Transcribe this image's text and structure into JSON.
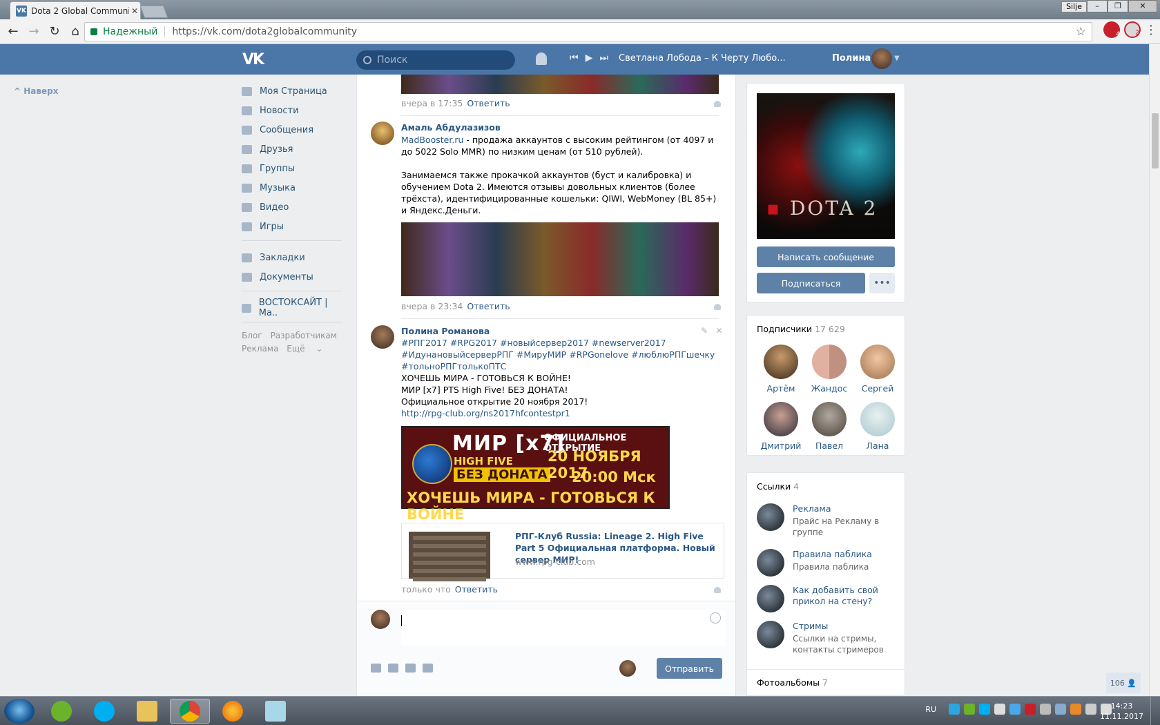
{
  "browser": {
    "tab_title": "Dota 2 Global Communi",
    "tab_favicon": "vk",
    "window_user": "Silje",
    "secure_label": "Надежный",
    "url": "https://vk.com/dota2globalcommunity",
    "ext_badges": [
      "4",
      "2"
    ]
  },
  "vk_header": {
    "logo": "VK",
    "search_placeholder": "Поиск",
    "track": "Светлана Лобода – К Черту Любо...",
    "user_name": "Полина"
  },
  "left_nav": {
    "back_to_top": "Наверх",
    "items": [
      {
        "label": "Моя Страница",
        "icon": "home-icon"
      },
      {
        "label": "Новости",
        "icon": "news-icon"
      },
      {
        "label": "Сообщения",
        "icon": "messages-icon"
      },
      {
        "label": "Друзья",
        "icon": "friends-icon"
      },
      {
        "label": "Группы",
        "icon": "groups-icon"
      },
      {
        "label": "Музыка",
        "icon": "music-icon"
      },
      {
        "label": "Видео",
        "icon": "video-icon"
      },
      {
        "label": "Игры",
        "icon": "games-icon"
      }
    ],
    "items2": [
      {
        "label": "Закладки",
        "icon": "star-icon"
      },
      {
        "label": "Документы",
        "icon": "document-icon"
      }
    ],
    "items3": [
      {
        "label": "ВОСТОКСАЙТ | Ма..",
        "icon": "group-icon"
      }
    ],
    "footer": [
      "Блог",
      "Разработчикам",
      "Реклама",
      "Ещё"
    ]
  },
  "wall": {
    "comment0": {
      "time": "вчера в 17:35",
      "reply": "Ответить"
    },
    "comment1": {
      "author": "Амаль Абдулазизов",
      "link": "MadBooster.ru",
      "text1": " - продажа аккаунтов с высоким рейтингом (от 4097 и до 5022 Solo MMR) по низким ценам (от 510 рублей).",
      "text2": "Занимаемся также прокачкой аккаунтов (буст и калибровка) и обучением Dota 2. Имеются отзывы довольных клиентов (более трёхста), идентифицированные кошельки: QIWI, WebMoney (BL 85+) и Яндекс.Деньги.",
      "time": "вчера в 23:34",
      "reply": "Ответить"
    },
    "comment2": {
      "author": "Полина Романова",
      "tags": "#РПГ2017 #RPG2017 #новыйсервер2017 #newserver2017 #ИдунановыйсерверРПГ #МируМИР #RPGonelove #люблюРПГшечку #тольноРПГтолькоПТС",
      "line1": "ХОЧЕШЬ МИРА - ГОТОВЬСЯ К ВОЙНЕ!",
      "line2": "МИР [x7] PTS High Five! БЕЗ ДОНАТА!",
      "line3": "Официальное открытие 20 ноября 2017!",
      "url": "http://rpg-club.org/ns2017hfcontestpr1",
      "banner": {
        "mir": "МИР [x7]",
        "high_five": "HIGH FIVE",
        "official": "ОФИЦИАЛЬНОЕ ОТКРЫТИЕ",
        "date": "20 НОЯБРЯ 2017",
        "time": "20:00 Мск",
        "no_donate": "БЕЗ ДОНАТА",
        "slogan": "ХОЧЕШЬ МИРА - ГОТОВЬСЯ К ВОЙНЕ"
      },
      "snippet_title": "РПГ-Клуб Russia: Lineage 2. High Five Part 5 Официальная платформа. Новый сервер МИР!",
      "snippet_domain": "www.rpg-club.com",
      "time": "только что",
      "reply": "Ответить"
    },
    "composer": {
      "send": "Отправить"
    }
  },
  "right": {
    "cover_text": "DOTA 2",
    "write_message": "Написать сообщение",
    "subscribe": "Подписаться",
    "more": "•••",
    "subscribers_label": "Подписчики",
    "subscribers_count": "17 629",
    "friends": [
      "Артём",
      "Жандос",
      "Сергей",
      "Дмитрий",
      "Павел",
      "Лана"
    ],
    "links_label": "Ссылки",
    "links_count": "4",
    "links": [
      {
        "title": "Реклама",
        "sub": "Прайс на Рекламу в группе"
      },
      {
        "title": "Правила паблика",
        "sub": "Правила паблика"
      },
      {
        "title": "Как добавить свой прикол на стену?",
        "sub": ""
      },
      {
        "title": "Стримы",
        "sub": "Ссылки на стримы, контакты стримеров"
      }
    ],
    "albums_label": "Фотоальбомы",
    "albums_count": "7"
  },
  "online_counter": "106",
  "taskbar": {
    "lang": "RU",
    "time": "14:23",
    "date": "11.11.2017"
  },
  "colors": {
    "vk_blue": "#4a76a8",
    "link": "#2a5885",
    "button": "#5e81a8"
  }
}
